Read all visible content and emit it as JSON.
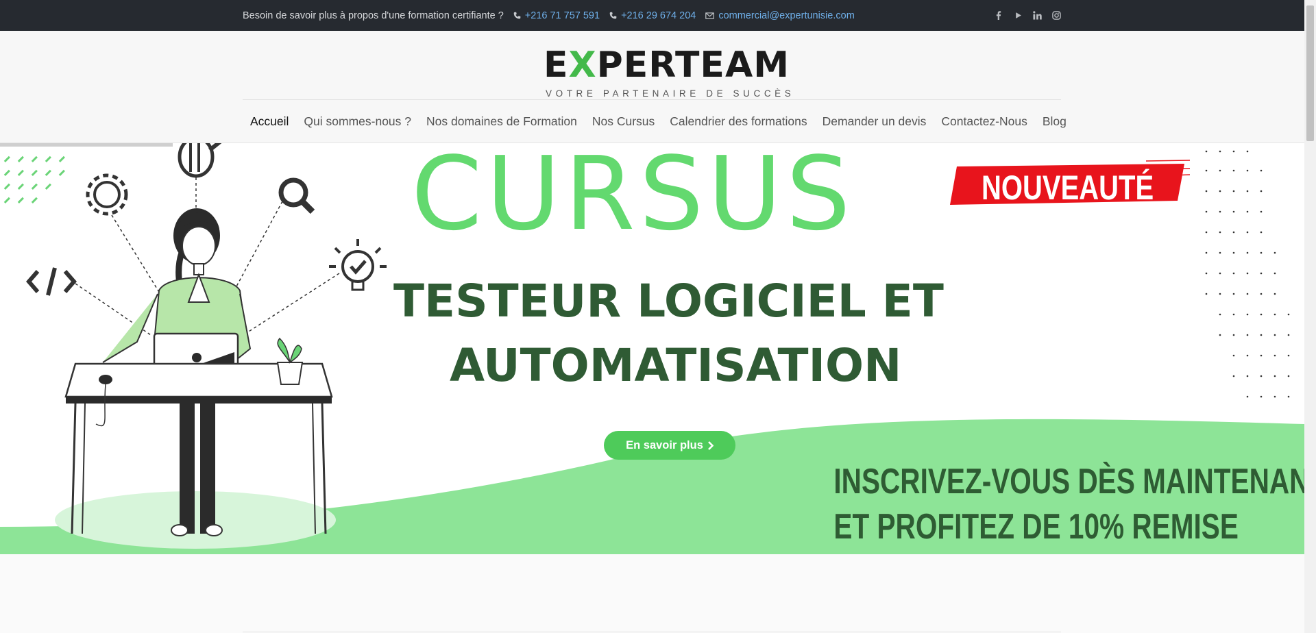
{
  "topbar": {
    "question": "Besoin de savoir plus à propos d'une formation certifiante ?",
    "phone1": "+216 71 757 591",
    "phone2": "+216 29 674 204",
    "email": "commercial@expertunisie.com",
    "socials": [
      "facebook-icon",
      "youtube-icon",
      "linkedin-icon",
      "instagram-icon"
    ]
  },
  "header": {
    "logo_pre": "E",
    "logo_x": "X",
    "logo_post": "PERTEAM",
    "logo_tagline": "VOTRE PARTENAIRE DE SUCCÈS",
    "nav": [
      "Accueil",
      "Qui sommes-nous ?",
      "Nos domaines de Formation",
      "Nos Cursus",
      "Calendrier des formations",
      "Demander un devis",
      "Contactez-Nous",
      "Blog"
    ],
    "active_nav": "Accueil"
  },
  "hero": {
    "title": "CURSUS",
    "badge": "NOUVEAUTÉ",
    "subtitle_line1": "TESTEUR LOGICIEL ET",
    "subtitle_line2": "AUTOMATISATION",
    "cta_label": "En savoir plus",
    "promo_line1": "INSCRIVEZ-VOUS DÈS MAINTENANT",
    "promo_line2": "ET PROFITEZ DE  10% REMISE"
  },
  "colors": {
    "brand_green": "#63d96f",
    "dark_green": "#2f5b34",
    "badge_red": "#e8141c",
    "topbar_bg": "#262a30",
    "link_blue": "#6fb0ea"
  }
}
